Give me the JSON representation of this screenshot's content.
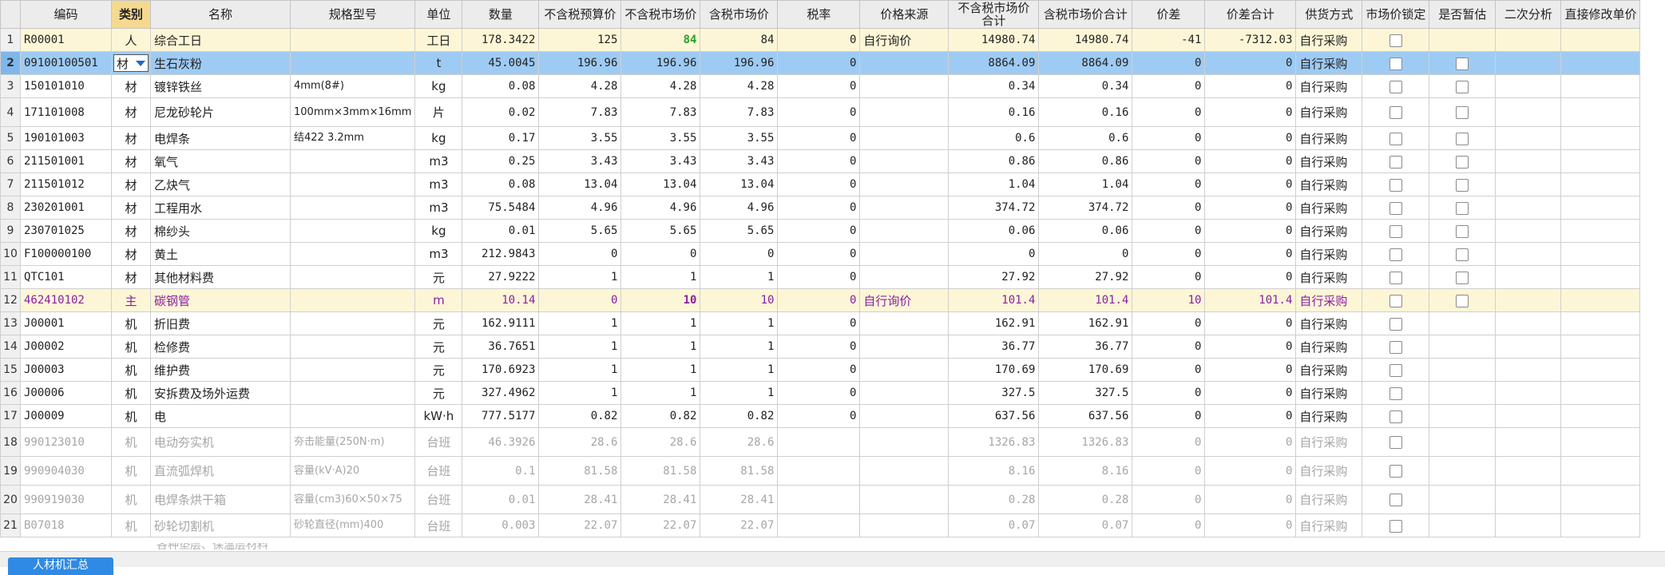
{
  "headers": {
    "code": "编码",
    "type": "类别",
    "name": "名称",
    "spec": "规格型号",
    "unit": "单位",
    "qty": "数量",
    "pretax_budget": "不含税预算价",
    "pretax_market": "不含税市场价",
    "tax_market": "含税市场价",
    "tax_rate": "税率",
    "price_source": "价格来源",
    "pretax_market_total": "不含税市场价合计",
    "tax_market_total": "含税市场价合计",
    "diff": "价差",
    "diff_total": "价差合计",
    "supply": "供货方式",
    "lock": "市场价锁定",
    "provisional": "是否暂估",
    "secondary": "二次分析",
    "direct_edit": "直接修改单价"
  },
  "rows": [
    {
      "no": "1",
      "code": "R00001",
      "type": "人",
      "name": "综合工日",
      "spec": "",
      "unit": "工日",
      "qty": "178.3422",
      "pb": "125",
      "pm": "84",
      "tm": "84",
      "rate": "0",
      "src": "自行询价",
      "pmt": "14980.74",
      "tmt": "14980.74",
      "diff": "-41",
      "difft": "-7312.03",
      "supply": "自行采购",
      "prov": false
    },
    {
      "no": "2",
      "code": "09100100501",
      "type": "材",
      "name": "生石灰粉",
      "spec": "",
      "unit": "t",
      "qty": "45.0045",
      "pb": "196.96",
      "pm": "196.96",
      "tm": "196.96",
      "rate": "0",
      "src": "",
      "pmt": "8864.09",
      "tmt": "8864.09",
      "diff": "0",
      "difft": "0",
      "supply": "自行采购",
      "prov": true
    },
    {
      "no": "3",
      "code": "150101010",
      "type": "材",
      "name": "镀锌铁丝",
      "spec": "4mm(8#)",
      "unit": "kg",
      "qty": "0.08",
      "pb": "4.28",
      "pm": "4.28",
      "tm": "4.28",
      "rate": "0",
      "src": "",
      "pmt": "0.34",
      "tmt": "0.34",
      "diff": "0",
      "difft": "0",
      "supply": "自行采购",
      "prov": true
    },
    {
      "no": "4",
      "code": "171101008",
      "type": "材",
      "name": "尼龙砂轮片",
      "spec": "100mm×3mm×16mm",
      "unit": "片",
      "qty": "0.02",
      "pb": "7.83",
      "pm": "7.83",
      "tm": "7.83",
      "rate": "0",
      "src": "",
      "pmt": "0.16",
      "tmt": "0.16",
      "diff": "0",
      "difft": "0",
      "supply": "自行采购",
      "prov": true
    },
    {
      "no": "5",
      "code": "190101003",
      "type": "材",
      "name": "电焊条",
      "spec": "结422 3.2mm",
      "unit": "kg",
      "qty": "0.17",
      "pb": "3.55",
      "pm": "3.55",
      "tm": "3.55",
      "rate": "0",
      "src": "",
      "pmt": "0.6",
      "tmt": "0.6",
      "diff": "0",
      "difft": "0",
      "supply": "自行采购",
      "prov": true
    },
    {
      "no": "6",
      "code": "211501001",
      "type": "材",
      "name": "氧气",
      "spec": "",
      "unit": "m3",
      "qty": "0.25",
      "pb": "3.43",
      "pm": "3.43",
      "tm": "3.43",
      "rate": "0",
      "src": "",
      "pmt": "0.86",
      "tmt": "0.86",
      "diff": "0",
      "difft": "0",
      "supply": "自行采购",
      "prov": true
    },
    {
      "no": "7",
      "code": "211501012",
      "type": "材",
      "name": "乙炔气",
      "spec": "",
      "unit": "m3",
      "qty": "0.08",
      "pb": "13.04",
      "pm": "13.04",
      "tm": "13.04",
      "rate": "0",
      "src": "",
      "pmt": "1.04",
      "tmt": "1.04",
      "diff": "0",
      "difft": "0",
      "supply": "自行采购",
      "prov": true
    },
    {
      "no": "8",
      "code": "230201001",
      "type": "材",
      "name": "工程用水",
      "spec": "",
      "unit": "m3",
      "qty": "75.5484",
      "pb": "4.96",
      "pm": "4.96",
      "tm": "4.96",
      "rate": "0",
      "src": "",
      "pmt": "374.72",
      "tmt": "374.72",
      "diff": "0",
      "difft": "0",
      "supply": "自行采购",
      "prov": true
    },
    {
      "no": "9",
      "code": "230701025",
      "type": "材",
      "name": "棉纱头",
      "spec": "",
      "unit": "kg",
      "qty": "0.01",
      "pb": "5.65",
      "pm": "5.65",
      "tm": "5.65",
      "rate": "0",
      "src": "",
      "pmt": "0.06",
      "tmt": "0.06",
      "diff": "0",
      "difft": "0",
      "supply": "自行采购",
      "prov": true
    },
    {
      "no": "10",
      "code": "F100000100",
      "type": "材",
      "name": "黄土",
      "spec": "",
      "unit": "m3",
      "qty": "212.9843",
      "pb": "0",
      "pm": "0",
      "tm": "0",
      "rate": "0",
      "src": "",
      "pmt": "0",
      "tmt": "0",
      "diff": "0",
      "difft": "0",
      "supply": "自行采购",
      "prov": true
    },
    {
      "no": "11",
      "code": "QTC101",
      "type": "材",
      "name": "其他材料费",
      "spec": "",
      "unit": "元",
      "qty": "27.9222",
      "pb": "1",
      "pm": "1",
      "tm": "1",
      "rate": "0",
      "src": "",
      "pmt": "27.92",
      "tmt": "27.92",
      "diff": "0",
      "difft": "0",
      "supply": "自行采购",
      "prov": true
    },
    {
      "no": "12",
      "code": "462410102",
      "type": "主",
      "name": "碳钢管",
      "spec": "",
      "unit": "m",
      "qty": "10.14",
      "pb": "0",
      "pm": "10",
      "tm": "10",
      "rate": "0",
      "src": "自行询价",
      "pmt": "101.4",
      "tmt": "101.4",
      "diff": "10",
      "difft": "101.4",
      "supply": "自行采购",
      "prov": true
    },
    {
      "no": "13",
      "code": "J00001",
      "type": "机",
      "name": "折旧费",
      "spec": "",
      "unit": "元",
      "qty": "162.9111",
      "pb": "1",
      "pm": "1",
      "tm": "1",
      "rate": "0",
      "src": "",
      "pmt": "162.91",
      "tmt": "162.91",
      "diff": "0",
      "difft": "0",
      "supply": "自行采购",
      "prov": false
    },
    {
      "no": "14",
      "code": "J00002",
      "type": "机",
      "name": "检修费",
      "spec": "",
      "unit": "元",
      "qty": "36.7651",
      "pb": "1",
      "pm": "1",
      "tm": "1",
      "rate": "0",
      "src": "",
      "pmt": "36.77",
      "tmt": "36.77",
      "diff": "0",
      "difft": "0",
      "supply": "自行采购",
      "prov": false
    },
    {
      "no": "15",
      "code": "J00003",
      "type": "机",
      "name": "维护费",
      "spec": "",
      "unit": "元",
      "qty": "170.6923",
      "pb": "1",
      "pm": "1",
      "tm": "1",
      "rate": "0",
      "src": "",
      "pmt": "170.69",
      "tmt": "170.69",
      "diff": "0",
      "difft": "0",
      "supply": "自行采购",
      "prov": false
    },
    {
      "no": "16",
      "code": "J00006",
      "type": "机",
      "name": "安拆费及场外运费",
      "spec": "",
      "unit": "元",
      "qty": "327.4962",
      "pb": "1",
      "pm": "1",
      "tm": "1",
      "rate": "0",
      "src": "",
      "pmt": "327.5",
      "tmt": "327.5",
      "diff": "0",
      "difft": "0",
      "supply": "自行采购",
      "prov": false
    },
    {
      "no": "17",
      "code": "J00009",
      "type": "机",
      "name": "电",
      "spec": "",
      "unit": "kW·h",
      "qty": "777.5177",
      "pb": "0.82",
      "pm": "0.82",
      "tm": "0.82",
      "rate": "0",
      "src": "",
      "pmt": "637.56",
      "tmt": "637.56",
      "diff": "0",
      "difft": "0",
      "supply": "自行采购",
      "prov": false
    },
    {
      "no": "18",
      "code": "990123010",
      "type": "机",
      "name": "电动夯实机",
      "spec": "夯击能量(250N·m)",
      "unit": "台班",
      "qty": "46.3926",
      "pb": "28.6",
      "pm": "28.6",
      "tm": "28.6",
      "rate": "",
      "src": "",
      "pmt": "1326.83",
      "tmt": "1326.83",
      "diff": "0",
      "difft": "0",
      "supply": "自行采购",
      "prov": false
    },
    {
      "no": "19",
      "code": "990904030",
      "type": "机",
      "name": "直流弧焊机",
      "spec": "容量(kV·A)20",
      "unit": "台班",
      "qty": "0.1",
      "pb": "81.58",
      "pm": "81.58",
      "tm": "81.58",
      "rate": "",
      "src": "",
      "pmt": "8.16",
      "tmt": "8.16",
      "diff": "0",
      "difft": "0",
      "supply": "自行采购",
      "prov": false
    },
    {
      "no": "20",
      "code": "990919030",
      "type": "机",
      "name": "电焊条烘干箱",
      "spec": "容量(cm3)60×50×75",
      "unit": "台班",
      "qty": "0.01",
      "pb": "28.41",
      "pm": "28.41",
      "tm": "28.41",
      "rate": "",
      "src": "",
      "pmt": "0.28",
      "tmt": "0.28",
      "diff": "0",
      "difft": "0",
      "supply": "自行采购",
      "prov": false
    },
    {
      "no": "21",
      "code": "B07018",
      "type": "机",
      "name": "砂轮切割机",
      "spec": "砂轮直径(mm)400",
      "unit": "台班",
      "qty": "0.003",
      "pb": "22.07",
      "pm": "22.07",
      "tm": "22.07",
      "rate": "",
      "src": "",
      "pmt": "0.07",
      "tmt": "0.07",
      "diff": "0",
      "difft": "0",
      "supply": "自行采购",
      "prov": false
    }
  ],
  "partial_row_name": "各种垫层、保温层材料",
  "bottom_tab": "人材机汇总"
}
